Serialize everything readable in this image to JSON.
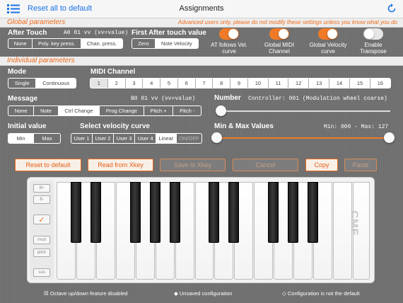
{
  "header": {
    "reset_all": "Reset all to default",
    "title": "Assignments",
    "menu_icon": "list-icon",
    "refresh_icon": "refresh-icon"
  },
  "global": {
    "section_label": "Global parameters",
    "warning": "Advanced users only, please do not modify these settings unless you know what you do",
    "after_touch": {
      "label": "After Touch",
      "code": "A0 01 vv (vv=value)",
      "options": [
        "None",
        "Poly. key press.",
        "Chan. press."
      ],
      "selected": "Chan. press."
    },
    "first_after_touch": {
      "label": "First After touch value",
      "options": [
        "Zero",
        "Note Velocity"
      ],
      "selected": "Note Velocity"
    },
    "toggles": [
      {
        "label": "AT follows Vel. curve",
        "on": true
      },
      {
        "label": "Global MIDI Channel",
        "on": true
      },
      {
        "label": "Global Velocity curve",
        "on": true
      },
      {
        "label": "Enable Transpose",
        "on": false
      }
    ]
  },
  "individual": {
    "section_label": "Individual parameters",
    "mode": {
      "label": "Mode",
      "options": [
        "Single",
        "Continuous"
      ],
      "selected": "Continuous"
    },
    "midi_channel": {
      "label": "MIDI Channel",
      "options": [
        "1",
        "2",
        "3",
        "4",
        "5",
        "6",
        "7",
        "8",
        "9",
        "10",
        "11",
        "12",
        "13",
        "14",
        "15",
        "16"
      ],
      "selected": "1"
    },
    "message": {
      "label": "Message",
      "code": "B0 01 vv (vv=value)",
      "options": [
        "None",
        "Note",
        "Ctrl Change",
        "Prog Change",
        "Pitch +",
        "Pitch -"
      ],
      "selected": "Ctrl Change"
    },
    "number": {
      "label": "Number",
      "value_text": "Controller: 001 (Modulation wheel coarse)",
      "position_fraction": 0.0
    },
    "initial_value": {
      "label": "Initial value",
      "options": [
        "Min",
        "Max"
      ],
      "selected": "Min"
    },
    "velocity_curve": {
      "label": "Select velocity curve",
      "options": [
        "User 1",
        "User 2",
        "User 3",
        "User 4",
        "Linear",
        "ON/OFF"
      ],
      "selected": "Linear",
      "disabled": [
        "ON/OFF"
      ]
    },
    "min_max": {
      "label": "Min & Max Values",
      "value_text": "Min: 000 - Max: 127",
      "min_fraction": 0.0,
      "max_fraction": 1.0
    }
  },
  "actions": [
    {
      "label": "Reset to default",
      "enabled": true
    },
    {
      "label": "Read from Xkey",
      "enabled": true
    },
    {
      "label": "Save to Xkey",
      "enabled": false
    },
    {
      "label": "Cancel",
      "enabled": false
    },
    {
      "label": "Copy",
      "enabled": true
    },
    {
      "label": "Paste",
      "enabled": false
    }
  ],
  "keyboard": {
    "brand": "CME",
    "side_buttons": [
      "8+",
      "8-",
      "✓",
      "mod",
      "pitch",
      "sus"
    ]
  },
  "footer": {
    "octave": "☒ Octave up/down feature disabled",
    "unsaved": "◆ Unsaved configuration",
    "not_default": "◇ Configuration is not the default"
  },
  "colors": {
    "accent": "#f07a28",
    "link": "#1a73e8"
  }
}
